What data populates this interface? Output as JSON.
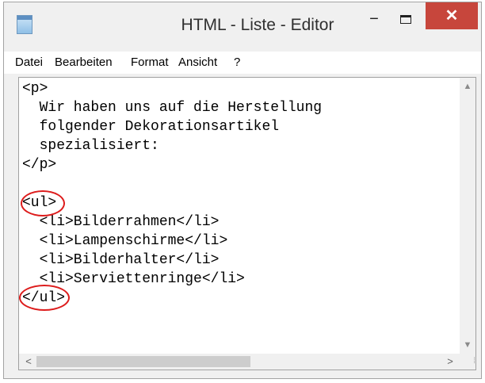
{
  "window": {
    "title": "HTML - Liste - Editor",
    "icon": "notepad-icon",
    "controls": {
      "minimize_symbol": "−",
      "close_symbol": "✕"
    }
  },
  "menu": {
    "items": [
      "Datei",
      "Bearbeiten",
      "Format",
      "Ansicht",
      "?"
    ]
  },
  "editor": {
    "lines": [
      "<p>",
      "  Wir haben uns auf die Herstellung",
      "  folgender Dekorationsartikel",
      "  spezialisiert:",
      "</p>",
      "",
      "<ul>",
      "  <li>Bilderrahmen</li>",
      "  <li>Lampenschirme</li>",
      "  <li>Bilderhalter</li>",
      "  <li>Serviettenringe</li>",
      "</ul>"
    ]
  },
  "scrollbars": {
    "up_arrow": "▲",
    "down_arrow": "▼",
    "left_arrow": "<",
    "right_arrow": ">",
    "grip": "⁞"
  },
  "annotations": {
    "color": "#dd1c1c"
  }
}
